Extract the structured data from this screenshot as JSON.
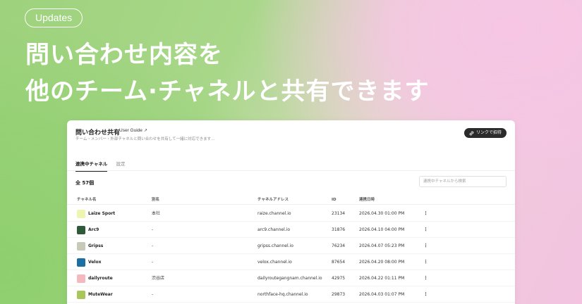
{
  "badge": "Updates",
  "headline": {
    "line1": "問い合わせ内容を",
    "line2": "他のチーム·チャネルと共有できます"
  },
  "panel": {
    "title": "問い合わせ共有",
    "guide_label": "User Guide",
    "guide_icon": "↗",
    "description": "チーム・メンバー・外部チャネルと問い合わせを共有して一緒に対応できます...",
    "invite_label": "リンクで招待",
    "invite_icon": "link-icon"
  },
  "tabs": [
    {
      "label": "連携中チャネル",
      "active": true
    },
    {
      "label": "設定",
      "active": false
    }
  ],
  "count_label": "全 57個",
  "search": {
    "placeholder": "連携中チャネルから検索"
  },
  "columns": {
    "name": "チャネル名",
    "alias": "別名",
    "address": "チャネルアドレス",
    "id": "ID",
    "date": "連携日時"
  },
  "rows": [
    {
      "name": "Laize Sport",
      "color": "#eef5b0",
      "alias": "本社",
      "address": "raize.channel.io",
      "id": "23134",
      "date": "2026.04.30 01:00 PM"
    },
    {
      "name": "Arc9",
      "color": "#2f5a3a",
      "alias": "-",
      "address": "arc9.channel.io",
      "id": "31876",
      "date": "2026.04.10 04:00 PM"
    },
    {
      "name": "Gripss",
      "color": "#c9c9b8",
      "alias": "-",
      "address": "gripss.channel.io",
      "id": "76234",
      "date": "2026.04.07 05:23 PM"
    },
    {
      "name": "Velox",
      "color": "#1d6fa3",
      "alias": "-",
      "address": "velox.channel.io",
      "id": "87654",
      "date": "2026.04.20 08:00 PM"
    },
    {
      "name": "dailyroute",
      "color": "#f6b8bf",
      "alias": "渋谷店",
      "address": "dailyroutegangnam.channel.io",
      "id": "42975",
      "date": "2026.04.22 01:11 PM"
    },
    {
      "name": "MuteWear",
      "color": "#a9c65a",
      "alias": "-",
      "address": "northface-hq.channel.io",
      "id": "29873",
      "date": "2026.04.03 01:07 PM"
    }
  ],
  "more_icon": "⋮"
}
